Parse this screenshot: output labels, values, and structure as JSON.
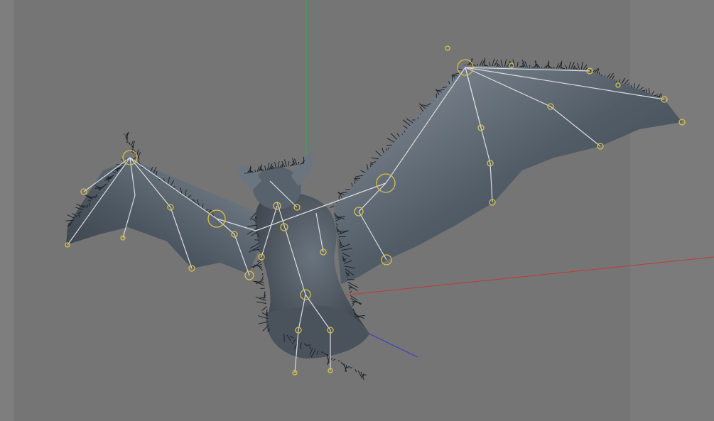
{
  "viewport": {
    "label": "",
    "background_color": "#757575",
    "side_panel_color": "#7b7b7b"
  },
  "axes": {
    "x_color": "#c23a3a",
    "y_color": "#3aa83a",
    "z_color": "#3a3ad0"
  },
  "model": {
    "name": "",
    "mesh_color": "#4d5761",
    "mesh_highlight_color": "#aab4be",
    "bone_color": "#d9dde2",
    "joint_color": "#d8c048",
    "fur_color": "#1e2328"
  }
}
